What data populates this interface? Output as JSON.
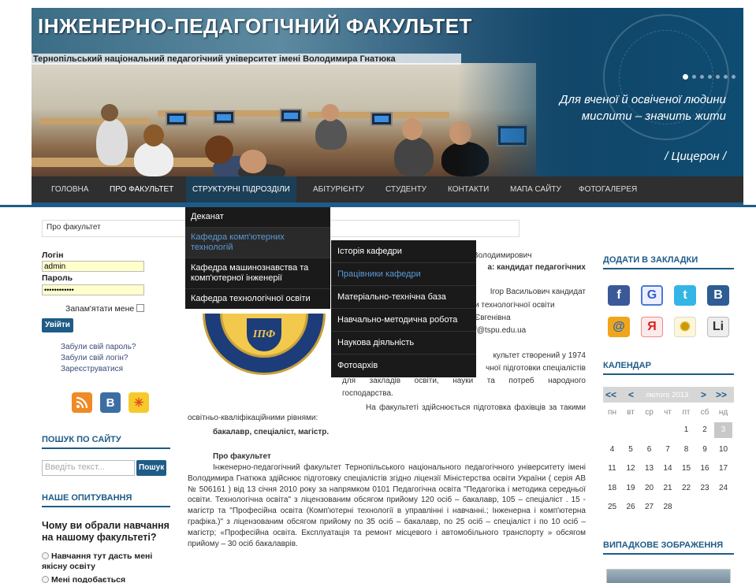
{
  "header": {
    "title": "ІНЖЕНЕРНО-ПЕДАГОГІЧНИЙ ФАКУЛЬТЕТ",
    "subtitle": "Тернопільський національний педагогічний університет імені Володимира Гнатюка",
    "quote_line1": "Для вченої й освіченої людини",
    "quote_line2": "мислити – значить жити",
    "quote_author": "/ Цицерон /"
  },
  "nav": {
    "items": [
      "ГОЛОВНА",
      "ПРО ФАКУЛЬТЕТ",
      "СТРУКТУРНІ ПІДРОЗДІЛИ",
      "АБІТУРІЄНТУ",
      "СТУДЕНТУ",
      "КОНТАКТИ",
      "МАПА САЙТУ",
      "ФОТОГАЛЕРЕЯ"
    ]
  },
  "breadcrumb": "Про факультет",
  "login": {
    "login_label": "Логін",
    "login_value": "admin",
    "password_label": "Пароль",
    "password_value": "••••••••••••",
    "remember_label": "Запам'ятати мене",
    "submit": "Увійти",
    "forgot_password": "Забули свій пароль?",
    "forgot_login": "Забули свій логін?",
    "register": "Зареєструватися"
  },
  "search": {
    "title": "ПОШУК ПО САЙТУ",
    "placeholder": "Введіть текст...",
    "button": "Пошук"
  },
  "poll": {
    "title": "НАШЕ ОПИТУВАННЯ",
    "question": "Чому ви обрали навчання на нашому факультеті?",
    "option1": "Навчання тут дасть мені якісну освіту",
    "option2": "Мені подобається"
  },
  "dropdown_main": {
    "items": [
      "Деканат",
      "Кафедра комп'ютерних технологій",
      "Кафедра машинознавства та комп'ютерної інженерії",
      "Кафедра технологічної освіти"
    ]
  },
  "dropdown_sub": {
    "items": [
      "Історія кафедри",
      "Працівники кафедри",
      "Матеріально-технічна база",
      "Навчально-методична робота",
      "Наукова діяльність",
      "Фотоархів"
    ]
  },
  "content": {
    "frag1": "Володимирович",
    "frag2": "а: кандидат педагогічних",
    "frag3": "Ігор Васильович кандидат",
    "frag4": "и технологічної освіти",
    "frag5": "Євгенівна",
    "frag6": "f@tspu.edu.ua",
    "frag7": "культет створений у 1974",
    "frag8": "чної підготовки спеціалістів",
    "frag9": "для закладів освіти, науки та потреб народного",
    "frag10": "господарства.",
    "para_intro": "На факультеті здійснюється підготовка фахівців за такими освітньо-кваліфікаційними рівнями:",
    "levels": "бакалавр, спеціаліст, магістр.",
    "about_heading": "Про факультет",
    "about_text": "Інженерно-педагогічний факультет Тернопільського національного педагогічного університету імені Володимира Гнатюка здійснює підготовку спеціалістів згідно ліцензії Міністерства освіти України ( серія АВ № 506161 ) від 13 січня 2010 року за напрямком 0101 Педагогічна освіта \"Педагогіка і методика середньої освіти. Технологічна освіта\" з ліцензованим обсягом прийому 120 осіб – бакалавр, 105 – спеціаліст . 15 - магістр та \"Професійна освіта (Комп'ютерні технології в управлінні і навчанні.; Інженерна і комп'ютерна графіка.)\" з ліцензованим обсягом прийому по 35 осіб – бакалавр, по 25 осіб – спеціаліст і по 10 осіб – магістр; «Професійна освіта. Експлуатація та ремонт місцевого і автомобільного транспорту » обсягом прийому – 30 осіб бакалаврів."
  },
  "bookmarks": {
    "title": "ДОДАТИ В ЗАКЛАДКИ",
    "icons": [
      "facebook-icon",
      "google-icon",
      "twitter-icon",
      "vkontakte-icon",
      "mail-icon",
      "yandex-icon",
      "ukrnet-icon",
      "liveinternet-icon"
    ]
  },
  "calendar": {
    "title": "КАЛЕНДАР",
    "prev_year": "<<",
    "prev_month": "<",
    "month": "лютого 2013",
    "next_month": ">",
    "next_year": ">>",
    "weekdays": [
      "пн",
      "вт",
      "ср",
      "чт",
      "пт",
      "сб",
      "нд"
    ],
    "weeks": [
      [
        "",
        "",
        "",
        "",
        "1",
        "2",
        "3"
      ],
      [
        "4",
        "5",
        "6",
        "7",
        "8",
        "9",
        "10"
      ],
      [
        "11",
        "12",
        "13",
        "14",
        "15",
        "16",
        "17"
      ],
      [
        "18",
        "19",
        "20",
        "21",
        "22",
        "23",
        "24"
      ],
      [
        "25",
        "26",
        "27",
        "28",
        "",
        "",
        ""
      ]
    ],
    "today": "3"
  },
  "random_image": {
    "title": "ВИПАДКОВЕ ЗОБРАЖЕННЯ"
  },
  "colors": {
    "accent": "#1e5c87",
    "nav_bg": "#2f2f2f",
    "dropdown_bg": "#1a1a1a",
    "dropdown_selected": "#5b9ad6"
  }
}
